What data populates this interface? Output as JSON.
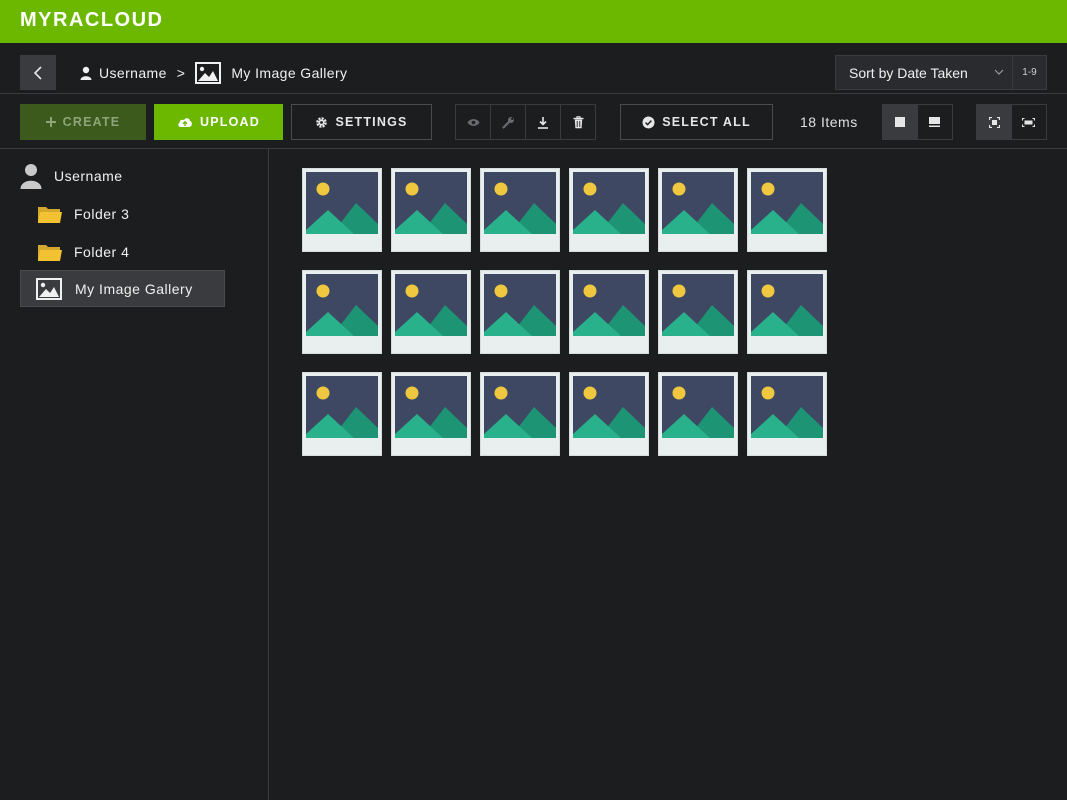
{
  "app": {
    "title": "MYRACLOUD"
  },
  "colors": {
    "brand": "#6cb800",
    "background": "#1c1d1f",
    "panel": "#3a3b3e"
  },
  "breadcrumb": {
    "user_label": "Username",
    "separator": ">",
    "current_label": "My Image Gallery"
  },
  "sort": {
    "selected": "Sort by Date Taken",
    "page_range": "1-9"
  },
  "toolbar": {
    "create_label": "CREATE",
    "upload_label": "UPLOAD",
    "settings_label": "SETTINGS",
    "select_all_label": "SELECT ALL",
    "items_count": "18 Items",
    "icon_buttons": [
      "eye-icon",
      "wrench-icon",
      "download-icon",
      "trash-icon"
    ]
  },
  "sidebar": {
    "user_label": "Username",
    "folders": [
      {
        "label": "Folder 3",
        "icon": "folder-icon"
      },
      {
        "label": "Folder 4",
        "icon": "folder-icon"
      }
    ],
    "gallery_label": "My Image Gallery"
  },
  "gallery": {
    "count": 18,
    "thumbnail_icon": "image-placeholder-icon"
  }
}
